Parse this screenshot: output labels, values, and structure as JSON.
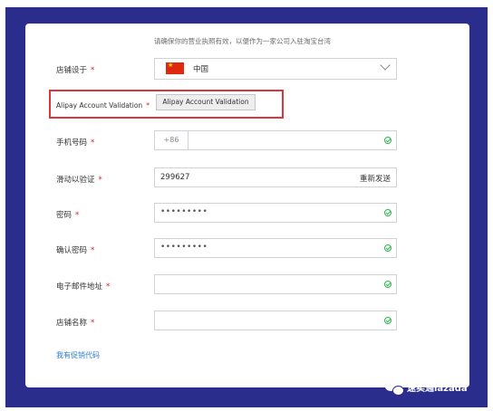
{
  "notice_text": "请确保你的营业执照有效，以便作为一家公司入驻淘宝台湾",
  "store_location": {
    "label": "店铺设于",
    "required_mark": "*",
    "country": "中国",
    "flag_icon": "china-flag-icon"
  },
  "alipay": {
    "label": "Alipay Account Validation",
    "required_mark": "*",
    "button_label": "Alipay Account Validation"
  },
  "phone": {
    "label": "手机号码",
    "required_mark": "*",
    "prefix": "+86",
    "value": ""
  },
  "slide_verify": {
    "label": "滑动以验证",
    "required_mark": "*",
    "value": "299627",
    "resend_label": "重新发送"
  },
  "password": {
    "label": "密码",
    "required_mark": "*",
    "masked_value": "•••••••••"
  },
  "confirm_password": {
    "label": "确认密码",
    "required_mark": "*",
    "masked_value": "•••••••••"
  },
  "email": {
    "label": "电子邮件地址",
    "required_mark": "*",
    "value": ""
  },
  "store_name": {
    "label": "店铺名称",
    "required_mark": "*",
    "value": ""
  },
  "promo_link": "我有促销代码",
  "watermark": {
    "text": "速卖通lazada",
    "icon": "wechat-icon"
  },
  "colors": {
    "frame": "#2b2d8c",
    "highlight_border": "#d9363e",
    "required": "#e0192f",
    "link": "#2a7fd4",
    "valid_check": "#2db44a"
  }
}
